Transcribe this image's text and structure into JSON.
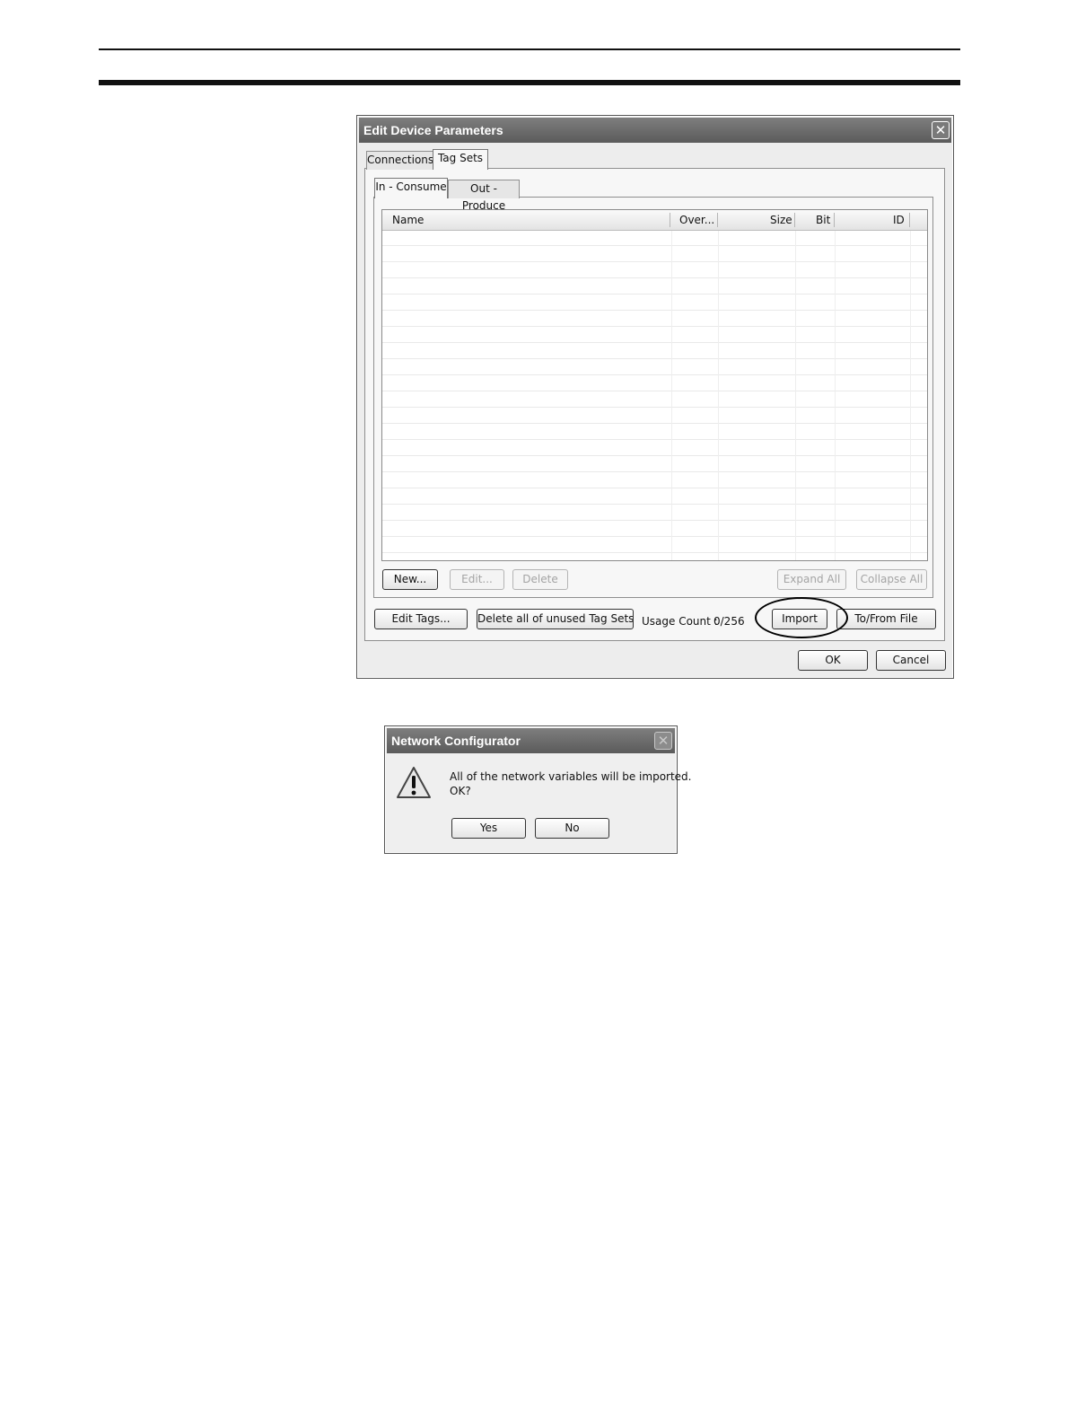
{
  "edit_dialog": {
    "title": "Edit Device Parameters",
    "tabs": [
      "Connections",
      "Tag Sets"
    ],
    "active_tab": "Tag Sets",
    "subtabs": [
      "In - Consume",
      "Out - Produce"
    ],
    "active_subtab": "In - Consume",
    "table": {
      "columns": [
        "Name",
        "Over...",
        "Size",
        "Bit",
        "ID"
      ],
      "rows": []
    },
    "buttons": {
      "new": "New...",
      "edit": "Edit...",
      "delete": "Delete",
      "expand_all": "Expand All",
      "collapse_all": "Collapse All",
      "edit_tags": "Edit Tags...",
      "delete_unused": "Delete all of unused Tag Sets",
      "import": "Import",
      "to_from_file": "To/From File",
      "ok": "OK",
      "cancel": "Cancel"
    },
    "usage_count_label": "Usage Count :",
    "usage_count_value": "0/256",
    "close_icon": "close-icon"
  },
  "confirm_dialog": {
    "title": "Network Configurator",
    "message_line1": "All of the network variables will be imported.",
    "message_line2": "OK?",
    "icon": "warning-icon",
    "buttons": {
      "yes": "Yes",
      "no": "No"
    }
  }
}
